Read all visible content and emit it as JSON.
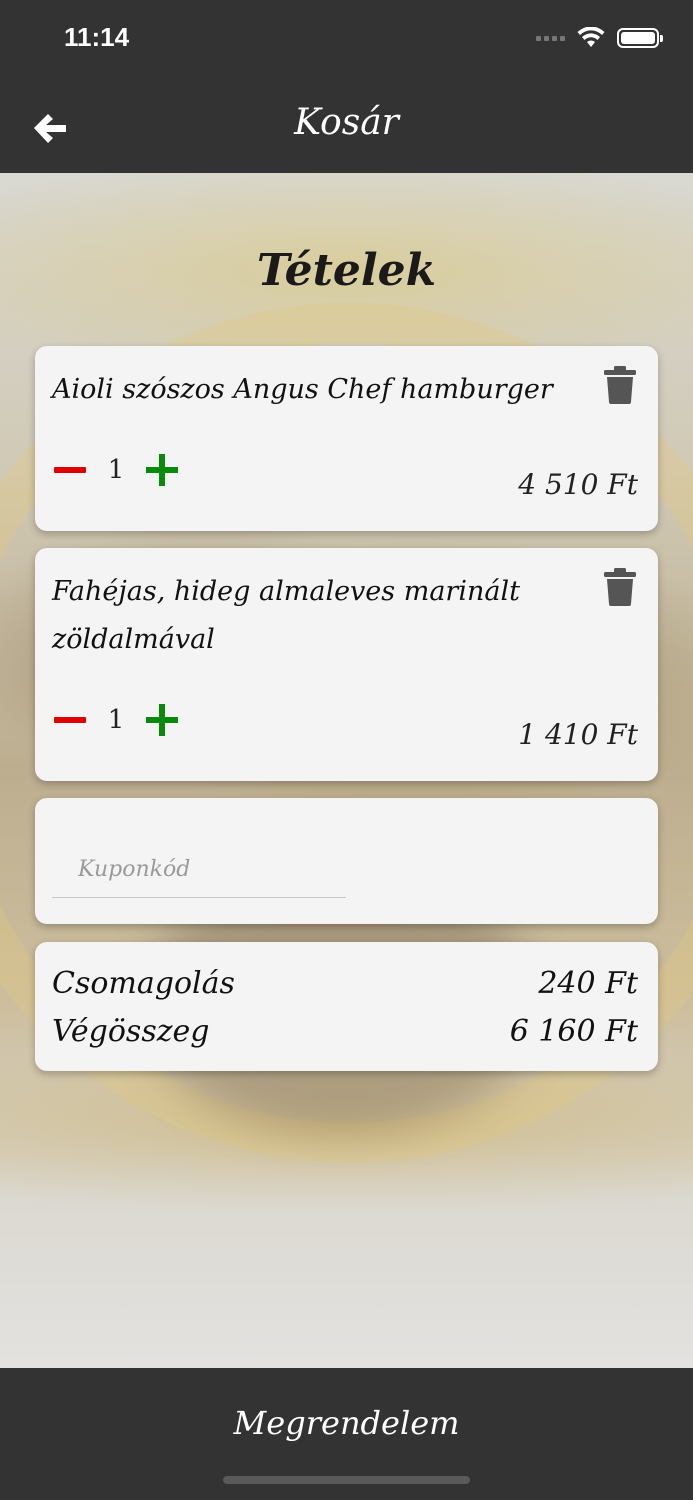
{
  "status_bar": {
    "time": "11:14"
  },
  "header": {
    "title": "Kosár"
  },
  "section": {
    "title": "Tételek"
  },
  "items": [
    {
      "name": "Aioli szószos Angus Chef hamburger",
      "quantity": "1",
      "price": "4 510 Ft"
    },
    {
      "name": "Fahéjas, hideg almaleves marinált zöldalmával",
      "quantity": "1",
      "price": "1 410 Ft"
    }
  ],
  "coupon": {
    "placeholder": "Kuponkód",
    "value": ""
  },
  "summary": {
    "packaging_label": "Csomagolás",
    "packaging_value": "240 Ft",
    "total_label": "Végösszeg",
    "total_value": "6 160 Ft"
  },
  "footer": {
    "order_label": "Megrendelem"
  },
  "colors": {
    "bar": "#333333",
    "minus": "#e10000",
    "plus": "#0a8a0a",
    "card": "#f4f4f4"
  }
}
